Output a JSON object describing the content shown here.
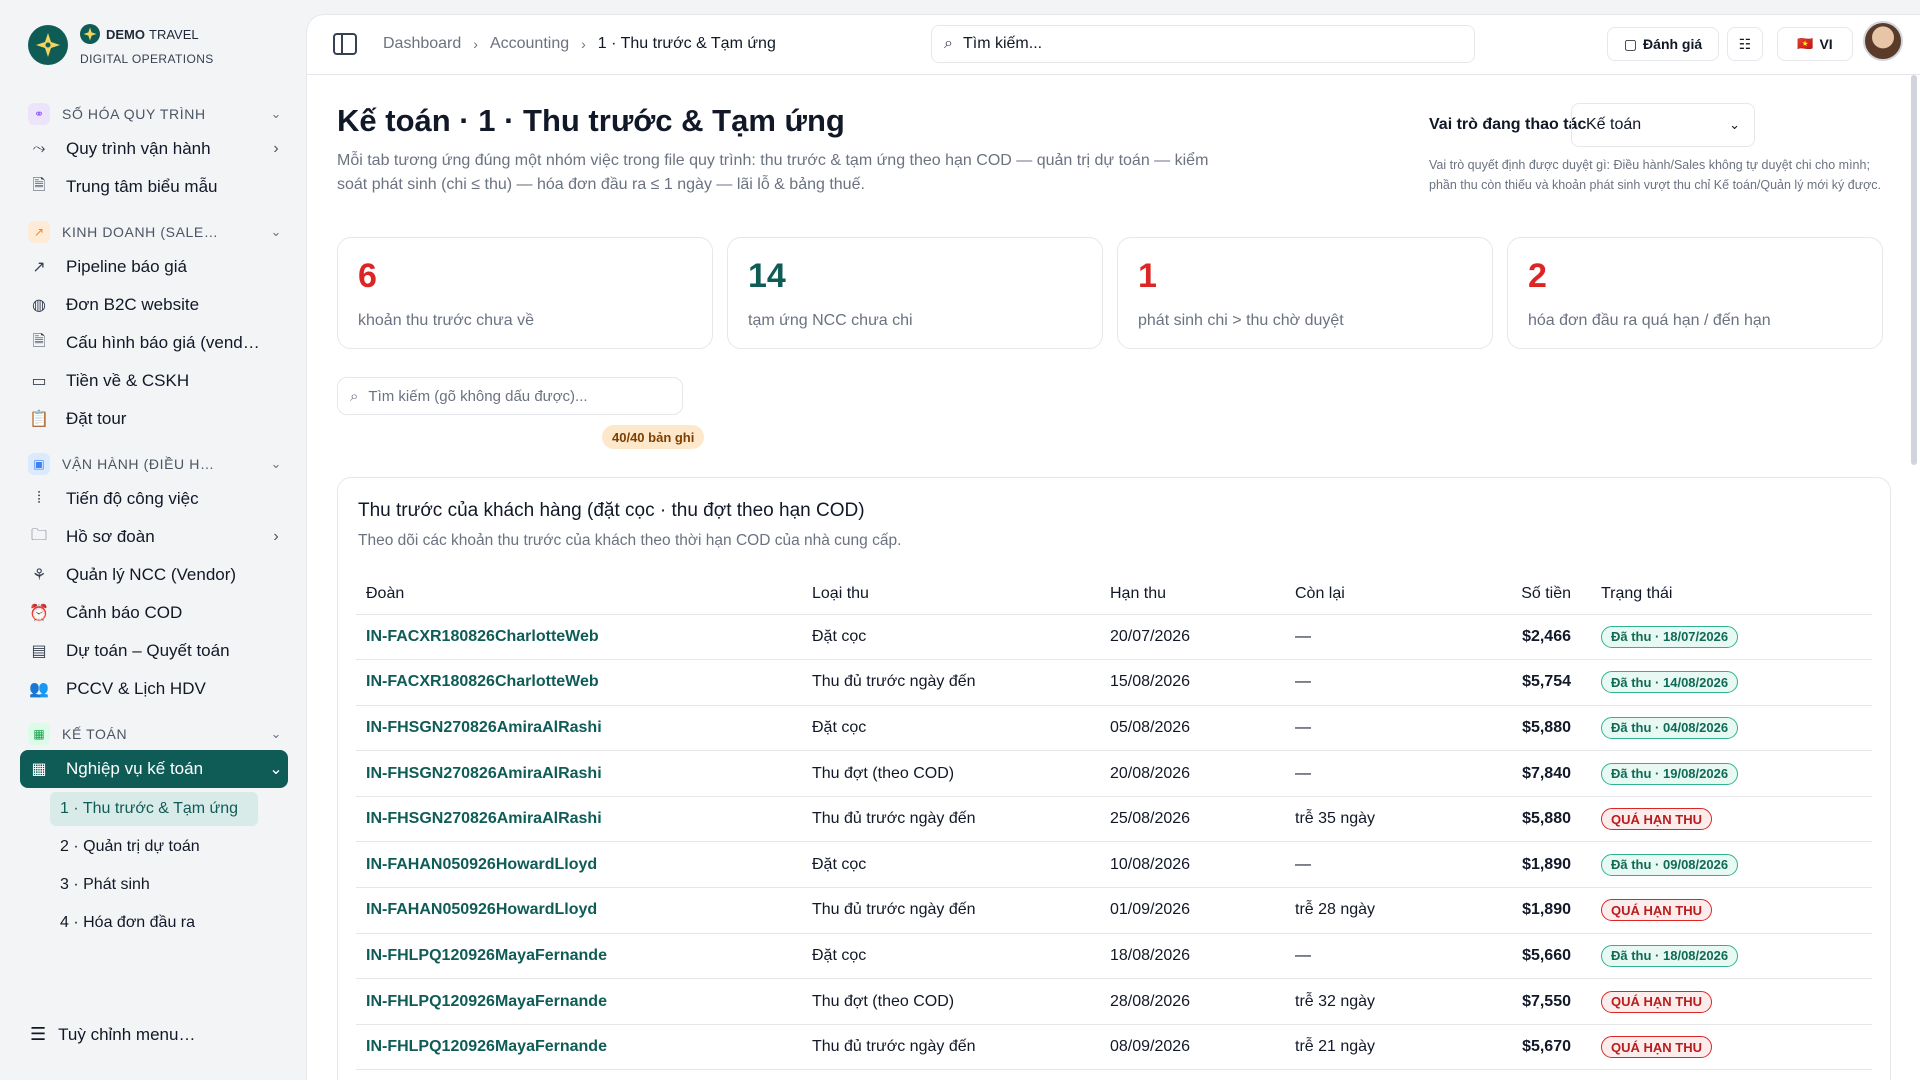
{
  "brand": {
    "name": "DEMO",
    "name_suffix": "TRAVEL",
    "subtitle": "DIGITAL OPERATIONS"
  },
  "sidebar": {
    "sections": [
      {
        "label": "SỐ HÓA QUY TRÌNH",
        "items": [
          {
            "label": "Quy trình vận hành",
            "icon": "route-icon",
            "arrow": true
          },
          {
            "label": "Trung tâm biểu mẫu",
            "icon": "file-icon",
            "arrow": false
          }
        ]
      },
      {
        "label": "KINH DOANH (SALE…",
        "items": [
          {
            "label": "Pipeline báo giá",
            "icon": "trend-icon"
          },
          {
            "label": "Đơn B2C website",
            "icon": "globe-icon"
          },
          {
            "label": "Cấu hình báo giá (vend…",
            "icon": "file-icon"
          },
          {
            "label": "Tiền về & CSKH",
            "icon": "ticket-icon"
          },
          {
            "label": "Đặt tour",
            "icon": "clipboard-icon"
          }
        ]
      },
      {
        "label": "VẬN HÀNH (ĐIỀU H…",
        "items": [
          {
            "label": "Tiến độ công việc",
            "icon": "progress-icon"
          },
          {
            "label": "Hồ sơ đoàn",
            "icon": "folder-icon",
            "arrow": true
          },
          {
            "label": "Quản lý NCC (Vendor)",
            "icon": "handshake-icon"
          },
          {
            "label": "Cảnh báo COD",
            "icon": "alarm-icon"
          },
          {
            "label": "Dự toán – Quyết toán",
            "icon": "calc-icon"
          },
          {
            "label": "PCCV & Lịch HDV",
            "icon": "users-icon"
          }
        ]
      },
      {
        "label": "KẾ TOÁN",
        "active_item": "Nghiệp vụ kế toán",
        "subitems": [
          "1 · Thu trước & Tạm ứng",
          "2 · Quản trị dự toán",
          "3 · Phát sinh",
          "4 · Hóa đơn đầu ra"
        ]
      }
    ],
    "customize": "Tuỳ chỉnh menu…"
  },
  "topbar": {
    "crumbs": [
      "Dashboard",
      "Accounting",
      "1 · Thu trước & Tạm ứng"
    ],
    "search_placeholder": "Tìm kiếm...",
    "feedback_label": "Đánh giá",
    "lang_label": "VI",
    "flag": "🇻🇳"
  },
  "header": {
    "title": "Kế toán · 1 · Thu trước & Tạm ứng",
    "description": "Mỗi tab tương ứng đúng một nhóm việc trong file quy trình: thu trước & tạm ứng theo hạn COD — quản trị dự toán — kiểm soát phát sinh (chi ≤ thu) — hóa đơn đầu ra ≤ 1 ngày — lãi lỗ & bảng thuế.",
    "role_label": "Vai trò đang thao tác",
    "role_value": "Kế toán",
    "role_note": "Vai trò quyết định được duyệt gì: Điều hành/Sales không tự duyệt chi cho mình; phần thu còn thiếu và khoản phát sinh vượt thu chỉ Kế toán/Quản lý mới ký được."
  },
  "stats": [
    {
      "value": "6",
      "label": "khoản thu trước chưa về",
      "color": "#dc2626"
    },
    {
      "value": "14",
      "label": "tạm ứng NCC chưa chi",
      "color": "#0f5c57"
    },
    {
      "value": "1",
      "label": "phát sinh chi > thu chờ duyệt",
      "color": "#dc2626"
    },
    {
      "value": "2",
      "label": "hóa đơn đầu ra quá hạn / đến hạn",
      "color": "#dc2626"
    }
  ],
  "filter": {
    "placeholder": "Tìm kiếm (gõ không dấu được)...",
    "count": "40/40 bản ghi"
  },
  "table": {
    "title": "Thu trước của khách hàng (đặt cọc · thu đợt theo hạn COD)",
    "description": "Theo dõi các khoản thu trước của khách theo thời hạn COD của nhà cung cấp.",
    "headers": [
      "Đoàn",
      "Loại thu",
      "Hạn thu",
      "Còn lại",
      "Số tiền",
      "Trạng thái"
    ],
    "rows": [
      {
        "group": "IN-FACXR180826CharlotteWeb",
        "type": "Đặt cọc",
        "due": "20/07/2026",
        "remaining": "—",
        "amount": "$2,466",
        "status": "Đã thu · 18/07/2026",
        "kind": "paid"
      },
      {
        "group": "IN-FACXR180826CharlotteWeb",
        "type": "Thu đủ trước ngày đến",
        "due": "15/08/2026",
        "remaining": "—",
        "amount": "$5,754",
        "status": "Đã thu · 14/08/2026",
        "kind": "paid"
      },
      {
        "group": "IN-FHSGN270826AmiraAlRashi",
        "type": "Đặt cọc",
        "due": "05/08/2026",
        "remaining": "—",
        "amount": "$5,880",
        "status": "Đã thu · 04/08/2026",
        "kind": "paid"
      },
      {
        "group": "IN-FHSGN270826AmiraAlRashi",
        "type": "Thu đợt (theo COD)",
        "due": "20/08/2026",
        "remaining": "—",
        "amount": "$7,840",
        "status": "Đã thu · 19/08/2026",
        "kind": "paid"
      },
      {
        "group": "IN-FHSGN270826AmiraAlRashi",
        "type": "Thu đủ trước ngày đến",
        "due": "25/08/2026",
        "remaining": "trễ 35 ngày",
        "amount": "$5,880",
        "status": "QUÁ HẠN THU",
        "kind": "overdue"
      },
      {
        "group": "IN-FAHAN050926HowardLloyd",
        "type": "Đặt cọc",
        "due": "10/08/2026",
        "remaining": "—",
        "amount": "$1,890",
        "status": "Đã thu · 09/08/2026",
        "kind": "paid"
      },
      {
        "group": "IN-FAHAN050926HowardLloyd",
        "type": "Thu đủ trước ngày đến",
        "due": "01/09/2026",
        "remaining": "trễ 28 ngày",
        "amount": "$1,890",
        "status": "QUÁ HẠN THU",
        "kind": "overdue"
      },
      {
        "group": "IN-FHLPQ120926MayaFernande",
        "type": "Đặt cọc",
        "due": "18/08/2026",
        "remaining": "—",
        "amount": "$5,660",
        "status": "Đã thu · 18/08/2026",
        "kind": "paid"
      },
      {
        "group": "IN-FHLPQ120926MayaFernande",
        "type": "Thu đợt (theo COD)",
        "due": "28/08/2026",
        "remaining": "trễ 32 ngày",
        "amount": "$7,550",
        "status": "QUÁ HẠN THU",
        "kind": "overdue"
      },
      {
        "group": "IN-FHLPQ120926MayaFernande",
        "type": "Thu đủ trước ngày đến",
        "due": "08/09/2026",
        "remaining": "trễ 21 ngày",
        "amount": "$5,670",
        "status": "QUÁ HẠN THU",
        "kind": "overdue"
      }
    ]
  }
}
